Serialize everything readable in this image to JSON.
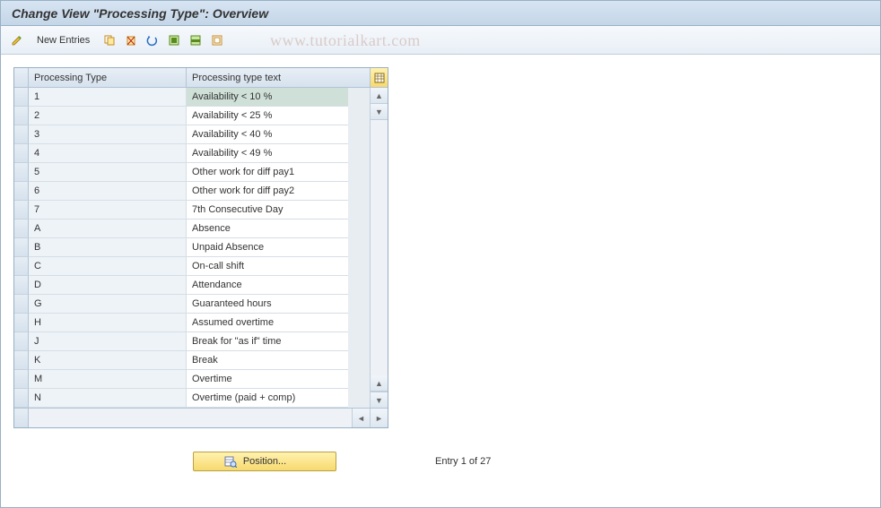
{
  "header": {
    "title": "Change View \"Processing Type\": Overview"
  },
  "watermark": "www.tutorialkart.com",
  "toolbar": {
    "new_entries_label": "New Entries",
    "icons": {
      "pencil": "pencil-icon",
      "copy": "copy-icon",
      "delete": "delete-icon",
      "undo": "undo-icon",
      "select_all": "select-all-icon",
      "select_block": "select-block-icon",
      "deselect": "deselect-icon"
    }
  },
  "grid": {
    "columns": {
      "type": "Processing Type",
      "text": "Processing type text"
    },
    "rows": [
      {
        "type": "1",
        "text": "Availability < 10 %"
      },
      {
        "type": "2",
        "text": "Availability < 25 %"
      },
      {
        "type": "3",
        "text": "Availability < 40 %"
      },
      {
        "type": "4",
        "text": "Availability < 49 %"
      },
      {
        "type": "5",
        "text": "Other work for diff pay1"
      },
      {
        "type": "6",
        "text": "Other work for diff pay2"
      },
      {
        "type": "7",
        "text": "7th Consecutive Day"
      },
      {
        "type": "A",
        "text": "Absence"
      },
      {
        "type": "B",
        "text": "Unpaid Absence"
      },
      {
        "type": "C",
        "text": "On-call shift"
      },
      {
        "type": "D",
        "text": "Attendance"
      },
      {
        "type": "G",
        "text": "Guaranteed hours"
      },
      {
        "type": "H",
        "text": "Assumed overtime"
      },
      {
        "type": "J",
        "text": "Break for \"as if\" time"
      },
      {
        "type": "K",
        "text": "Break"
      },
      {
        "type": "M",
        "text": "Overtime"
      },
      {
        "type": "N",
        "text": "Overtime (paid + comp)"
      }
    ],
    "selected_row_index": 0
  },
  "footer": {
    "position_label": "Position...",
    "entry_text": "Entry 1 of 27"
  }
}
